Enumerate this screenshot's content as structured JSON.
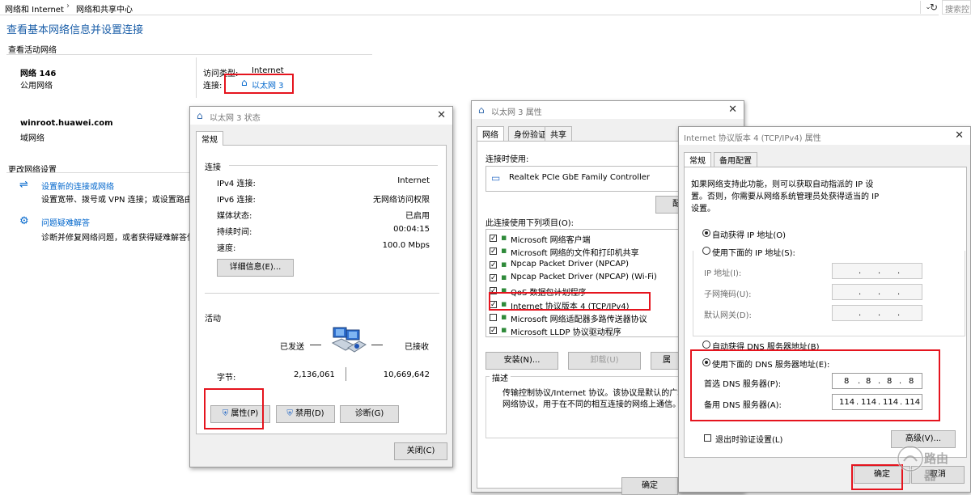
{
  "breadcrumb": {
    "item1": "网络和 Internet",
    "item2": "网络和共享中心",
    "separator": "›"
  },
  "search_placeholder": "搜索控",
  "header": {
    "title": "查看基本网络信息并设置连接",
    "active_networks_label": "查看活动网络"
  },
  "networks": [
    {
      "name": "网络 146",
      "type": "公用网络"
    },
    {
      "name": "winroot.huawei.com",
      "type": "域网络"
    }
  ],
  "access": {
    "type_label": "访问类型:",
    "type_value": "Internet",
    "conn_label": "连接:",
    "conn_value": "以太网 3"
  },
  "change_settings": {
    "title": "更改网络设置",
    "items": [
      {
        "title": "设置新的连接或网络",
        "desc": "设置宽带、拨号或 VPN 连接；或设置路由器"
      },
      {
        "title": "问题疑难解答",
        "desc": "诊断并修复网络问题，或者获得疑难解答信息。"
      }
    ]
  },
  "status_dialog": {
    "title": "以太网 3 状态",
    "tab": "常规",
    "connection_label": "连接",
    "rows": [
      {
        "label": "IPv4 连接:",
        "value": "Internet"
      },
      {
        "label": "IPv6 连接:",
        "value": "无网络访问权限"
      },
      {
        "label": "媒体状态:",
        "value": "已启用"
      },
      {
        "label": "持续时间:",
        "value": "00:04:15"
      },
      {
        "label": "速度:",
        "value": "100.0 Mbps"
      }
    ],
    "details_button": "详细信息(E)...",
    "activity_label": "活动",
    "sent_label": "已发送",
    "received_label": "已接收",
    "bytes_label": "字节:",
    "bytes_sent": "2,136,061",
    "bytes_received": "10,669,642",
    "properties_button": "属性(P)",
    "disable_button": "禁用(D)",
    "diagnose_button": "诊断(G)",
    "close_button": "关闭(C)"
  },
  "props_dialog": {
    "title": "以太网 3 属性",
    "tabs": [
      "网络",
      "身份验证",
      "共享"
    ],
    "connect_using_label": "连接时使用:",
    "adapter": "Realtek PCIe GbE Family Controller",
    "configure_button": "配",
    "items_label": "此连接使用下列项目(O):",
    "items": [
      {
        "label": "Microsoft 网络客户端",
        "checked": true
      },
      {
        "label": "Microsoft 网络的文件和打印机共享",
        "checked": true
      },
      {
        "label": "Npcap Packet Driver (NPCAP)",
        "checked": true
      },
      {
        "label": "Npcap Packet Driver (NPCAP) (Wi-Fi)",
        "checked": true
      },
      {
        "label": "QoS 数据包计划程序",
        "checked": true
      },
      {
        "label": "Internet 协议版本 4 (TCP/IPv4)",
        "checked": true
      },
      {
        "label": "Microsoft 网络适配器多路传送器协议",
        "checked": false
      },
      {
        "label": "Microsoft LLDP 协议驱动程序",
        "checked": true
      }
    ],
    "install_button": "安装(N)...",
    "uninstall_button": "卸载(U)",
    "props_button": "属",
    "description_label": "描述",
    "description_text": "传输控制协议/Internet 协议。该协议是默认的广域网络协议，用于在不同的相互连接的网络上通信。",
    "ok_button": "确定"
  },
  "ipv4_dialog": {
    "title": "Internet 协议版本 4 (TCP/IPv4) 属性",
    "tabs": [
      "常规",
      "备用配置"
    ],
    "intro": "如果网络支持此功能，则可以获取自动指派的 IP 设置。否则，你需要从网络系统管理员处获得适当的 IP 设置。",
    "auto_ip": "自动获得 IP 地址(O)",
    "manual_ip": "使用下面的 IP 地址(S):",
    "ip_label": "IP 地址(I):",
    "mask_label": "子网掩码(U):",
    "gateway_label": "默认网关(D):",
    "auto_dns": "自动获得 DNS 服务器地址(B)",
    "manual_dns": "使用下面的 DNS 服务器地址(E):",
    "preferred_dns_label": "首选 DNS 服务器(P):",
    "alternate_dns_label": "备用 DNS 服务器(A):",
    "preferred_dns": [
      "8",
      "8",
      "8",
      "8"
    ],
    "alternate_dns": [
      "114",
      "114",
      "114",
      "114"
    ],
    "validate_label": "退出时验证设置(L)",
    "advanced_button": "高级(V)...",
    "ok_button": "确定",
    "cancel_button": "取消"
  },
  "watermark": "路由器"
}
